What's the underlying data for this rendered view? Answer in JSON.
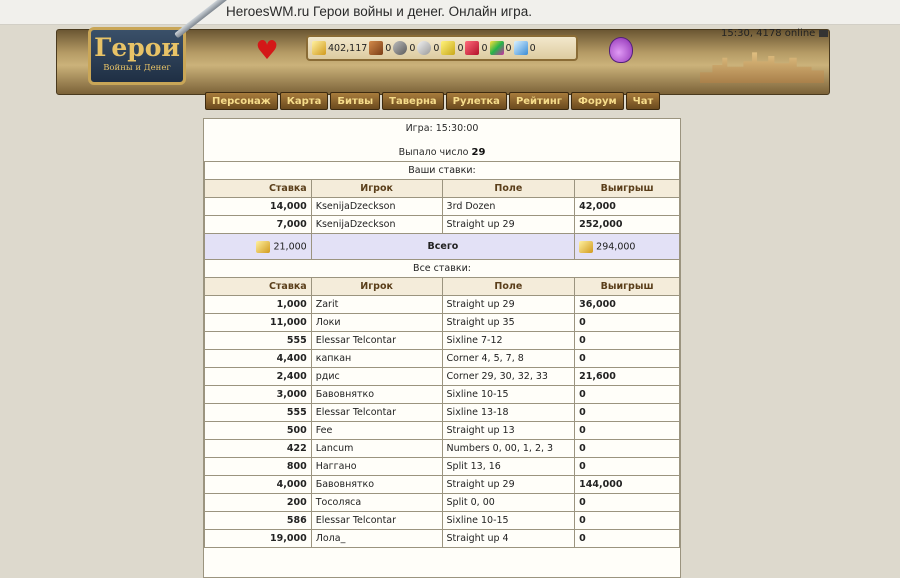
{
  "browser": {
    "title": "HeroesWM.ru Герои войны и денег. Онлайн игра."
  },
  "header": {
    "logo_title": "Герои",
    "logo_subtitle": "Войны и Денег",
    "online": "15:30, 4178 online",
    "resources": [
      {
        "name": "gold",
        "value": "402,117"
      },
      {
        "name": "wood",
        "value": "0"
      },
      {
        "name": "ore",
        "value": "0"
      },
      {
        "name": "mercury",
        "value": "0"
      },
      {
        "name": "sulfur",
        "value": "0"
      },
      {
        "name": "crystals",
        "value": "0"
      },
      {
        "name": "gems",
        "value": "0"
      },
      {
        "name": "diamonds",
        "value": "0"
      }
    ]
  },
  "nav": [
    "Персонаж",
    "Карта",
    "Битвы",
    "Таверна",
    "Рулетка",
    "Рейтинг",
    "Форум",
    "Чат"
  ],
  "game": {
    "time": "Игра: 15:30:00",
    "drop_label": "Выпало число",
    "drop_number": "29"
  },
  "your_bets": {
    "title": "Ваши ставки:",
    "headers": [
      "Ставка",
      "Игрок",
      "Поле",
      "Выигрыш"
    ],
    "rows": [
      {
        "bet": "14,000",
        "player": "KsenijaDzeckson",
        "field": "3rd Dozen",
        "win": "42,000"
      },
      {
        "bet": "7,000",
        "player": "KsenijaDzeckson",
        "field": "Straight up 29",
        "win": "252,000"
      }
    ],
    "total": {
      "bet": "21,000",
      "label": "Всего",
      "win": "294,000"
    }
  },
  "all_bets": {
    "title": "Все ставки:",
    "headers": [
      "Ставка",
      "Игрок",
      "Поле",
      "Выигрыш"
    ],
    "rows": [
      {
        "bet": "1,000",
        "player": "Zarit",
        "field": "Straight up 29",
        "win": "36,000"
      },
      {
        "bet": "11,000",
        "player": "Локи",
        "field": "Straight up 35",
        "win": "0"
      },
      {
        "bet": "555",
        "player": "Elessar Telcontar",
        "field": "Sixline 7-12",
        "win": "0"
      },
      {
        "bet": "4,400",
        "player": "капкан",
        "field": "Corner 4, 5, 7, 8",
        "win": "0"
      },
      {
        "bet": "2,400",
        "player": "рдис",
        "field": "Corner 29, 30, 32, 33",
        "win": "21,600"
      },
      {
        "bet": "3,000",
        "player": "Бавовнятко",
        "field": "Sixline 10-15",
        "win": "0"
      },
      {
        "bet": "555",
        "player": "Elessar Telcontar",
        "field": "Sixline 13-18",
        "win": "0"
      },
      {
        "bet": "500",
        "player": "Fee",
        "field": "Straight up 13",
        "win": "0"
      },
      {
        "bet": "422",
        "player": "Lancum",
        "field": "Numbers 0, 00, 1, 2, 3",
        "win": "0"
      },
      {
        "bet": "800",
        "player": "Наггано",
        "field": "Split 13, 16",
        "win": "0"
      },
      {
        "bet": "4,000",
        "player": "Бавовнятко",
        "field": "Straight up 29",
        "win": "144,000"
      },
      {
        "bet": "200",
        "player": "Тосоляса",
        "field": "Split 0, 00",
        "win": "0"
      },
      {
        "bet": "586",
        "player": "Elessar Telcontar",
        "field": "Sixline 10-15",
        "win": "0"
      },
      {
        "bet": "19,000",
        "player": "Лола_",
        "field": "Straight up 4",
        "win": "0"
      }
    ]
  }
}
